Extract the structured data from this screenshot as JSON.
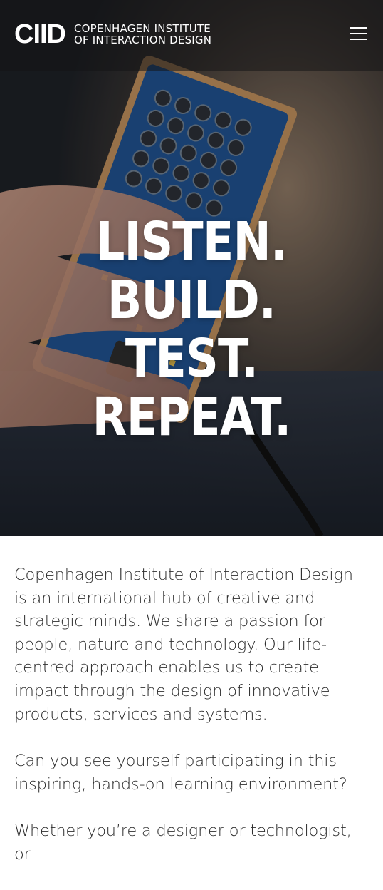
{
  "header": {
    "logo_mark": "CIID",
    "logo_line1": "COPENHAGEN INSTITUTE",
    "logo_line2": "OF INTERACTION DESIGN"
  },
  "hero": {
    "headline_line1": "LISTEN. BUILD.",
    "headline_line2": "TEST. REPEAT."
  },
  "icons": {
    "menu": "hamburger-menu-icon"
  },
  "colors": {
    "header_bg": "#141416",
    "headline": "#ffffff",
    "body_text": "#2f2f2f"
  },
  "main": {
    "paragraph1": "Copenhagen Institute of Interaction Design is an international hub of creative and strategic minds. We share a passion for people, nature and technology. Our life-centred approach enables us to create impact through the design of innovative products, services and systems.",
    "paragraph2": "Can you see yourself participating in this inspiring, hands-on learning environment?",
    "paragraph3": "Whether you’re a designer or technologist, or"
  }
}
